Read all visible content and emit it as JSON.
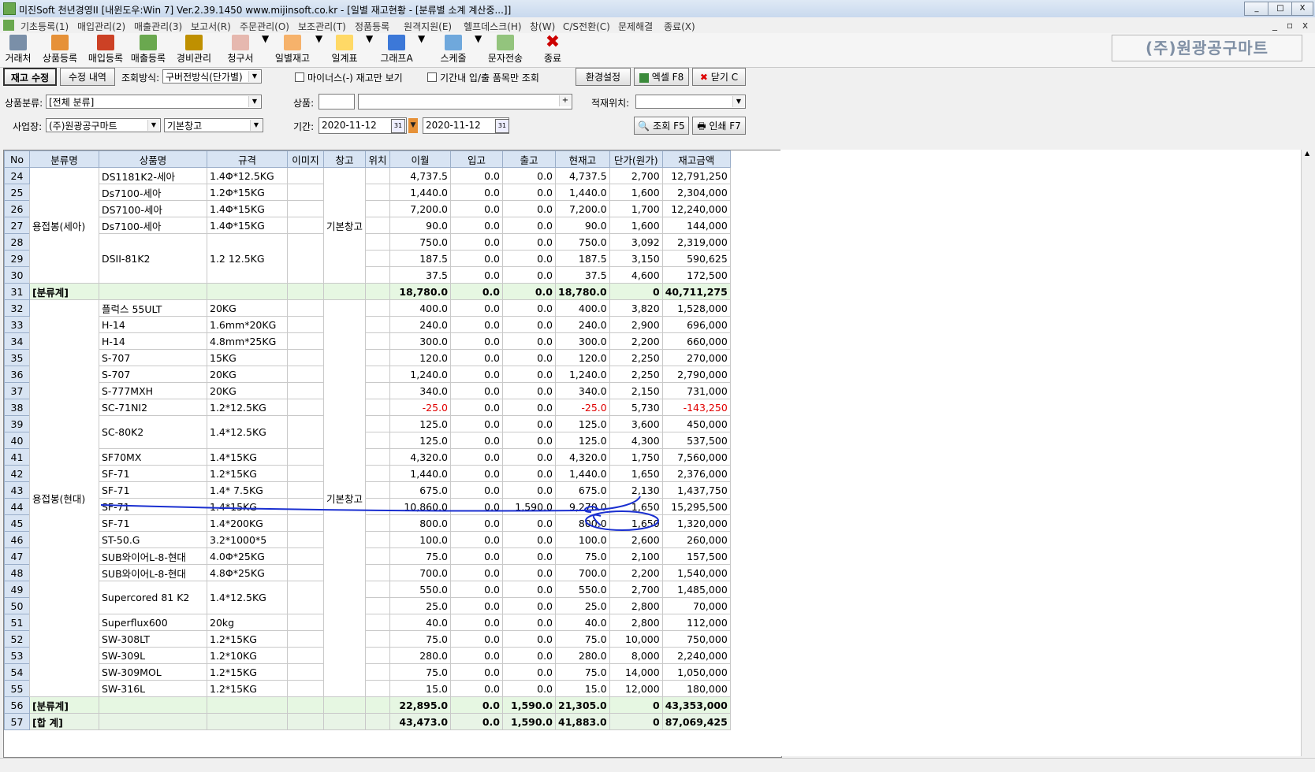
{
  "window": {
    "title": "미진Soft 천년경영II [내윈도우:Win 7] Ver.2.39.1450          www.mijinsoft.co.kr - [일별 재고현황 - [분류별 소계 계산중...]]",
    "minimize": "_",
    "restore": "□",
    "close": "X"
  },
  "menu": [
    "기초등록(1)",
    "매입관리(2)",
    "매출관리(3)",
    "보고서(R)",
    "주문관리(O)",
    "보조관리(T)",
    "정품등록",
    "원격지원(E)",
    "헬프데스크(H)",
    "창(W)",
    "C/S전환(C)",
    "문제해결",
    "종료(X)"
  ],
  "toolbar": [
    {
      "label": "거래처",
      "icon": "building-icon",
      "color": "#7a8fa8"
    },
    {
      "label": "상품등록",
      "icon": "box-add-icon",
      "color": "#e69138"
    },
    {
      "label": "매입등록",
      "icon": "purchase-icon",
      "color": "#cc4125"
    },
    {
      "label": "매출등록",
      "icon": "sales-icon",
      "color": "#6aa84f"
    },
    {
      "label": "경비관리",
      "icon": "money-icon",
      "color": "#bf9000"
    },
    {
      "label": "청구서",
      "icon": "invoice-icon",
      "color": "#e6b8af"
    },
    {
      "label": "일별재고",
      "icon": "daily-stock-icon",
      "color": "#f6b26b"
    },
    {
      "label": "일계표",
      "icon": "ledger-icon",
      "color": "#ffd966"
    },
    {
      "label": "그래프A",
      "icon": "chart-icon",
      "color": "#3c78d8"
    },
    {
      "label": "스케줄",
      "icon": "calendar-icon",
      "color": "#6fa8dc"
    },
    {
      "label": "문자전송",
      "icon": "sms-icon",
      "color": "#93c47d"
    },
    {
      "label": "종료",
      "icon": "close-x-icon",
      "color": "#cc0000"
    }
  ],
  "company_name": "(주)원광공구마트",
  "controls": {
    "stock_edit": "재고 수정",
    "edit_history": "수정 내역",
    "query_method_label": "조회방식:",
    "query_method_value": "구버전방식(단가별)",
    "minus_only": "마이너스(-) 재고만 보기",
    "period_inout_only": "기간내 입/출 품목만 조회",
    "env_settings": "환경설정",
    "excel": "엑셀 F8",
    "close": "닫기 C",
    "category_label": "상품분류:",
    "category_value": "[전체 분류]",
    "product_label": "상품:",
    "location_label": "적재위치:",
    "business_label": "사업장:",
    "business_value": "(주)원광공구마트",
    "warehouse_value": "기본창고",
    "period_label": "기간:",
    "date_from": "2020-11-12",
    "date_to": "2020-11-12",
    "search": "조회 F5",
    "print": "인쇄 F7"
  },
  "table": {
    "headers": [
      "No",
      "분류명",
      "상품명",
      "규격",
      "이미지",
      "창고",
      "위치",
      "이월",
      "입고",
      "출고",
      "현재고",
      "단가(원가)",
      "재고금액"
    ],
    "rows": [
      {
        "no": "24",
        "name": "DS1181K2-세아",
        "spec": "1.4Φ*12.5KG",
        "carry": "4,737.5",
        "in": "0.0",
        "out": "0.0",
        "stock": "4,737.5",
        "price": "2,700",
        "amount": "12,791,250"
      },
      {
        "no": "25",
        "name": "Ds7100-세아",
        "spec": "1.2Φ*15KG",
        "carry": "1,440.0",
        "in": "0.0",
        "out": "0.0",
        "stock": "1,440.0",
        "price": "1,600",
        "amount": "2,304,000"
      },
      {
        "no": "26",
        "name": "DS7100-세아",
        "spec": "1.4Φ*15KG",
        "carry": "7,200.0",
        "in": "0.0",
        "out": "0.0",
        "stock": "7,200.0",
        "price": "1,700",
        "amount": "12,240,000"
      },
      {
        "no": "27",
        "name": "Ds7100-세아",
        "spec": "1.4Φ*15KG",
        "carry": "90.0",
        "in": "0.0",
        "out": "0.0",
        "stock": "90.0",
        "price": "1,600",
        "amount": "144,000"
      },
      {
        "no": "28",
        "name": "",
        "spec": "",
        "carry": "750.0",
        "in": "0.0",
        "out": "0.0",
        "stock": "750.0",
        "price": "3,092",
        "amount": "2,319,000"
      },
      {
        "no": "29",
        "name": "DSII-81K2",
        "spec": "1.2 12.5KG",
        "carry": "187.5",
        "in": "0.0",
        "out": "0.0",
        "stock": "187.5",
        "price": "3,150",
        "amount": "590,625"
      },
      {
        "no": "30",
        "name": "",
        "spec": "",
        "carry": "37.5",
        "in": "0.0",
        "out": "0.0",
        "stock": "37.5",
        "price": "4,600",
        "amount": "172,500"
      },
      {
        "no": "31",
        "name": "",
        "spec": "",
        "carry": "18,780.0",
        "in": "0.0",
        "out": "0.0",
        "stock": "18,780.0",
        "price": "0",
        "amount": "40,711,275"
      },
      {
        "no": "32",
        "name": "플럭스 55ULT",
        "spec": "20KG",
        "carry": "400.0",
        "in": "0.0",
        "out": "0.0",
        "stock": "400.0",
        "price": "3,820",
        "amount": "1,528,000"
      },
      {
        "no": "33",
        "name": "H-14",
        "spec": "1.6mm*20KG",
        "carry": "240.0",
        "in": "0.0",
        "out": "0.0",
        "stock": "240.0",
        "price": "2,900",
        "amount": "696,000"
      },
      {
        "no": "34",
        "name": "H-14",
        "spec": "4.8mm*25KG",
        "carry": "300.0",
        "in": "0.0",
        "out": "0.0",
        "stock": "300.0",
        "price": "2,200",
        "amount": "660,000"
      },
      {
        "no": "35",
        "name": "S-707",
        "spec": "15KG",
        "carry": "120.0",
        "in": "0.0",
        "out": "0.0",
        "stock": "120.0",
        "price": "2,250",
        "amount": "270,000"
      },
      {
        "no": "36",
        "name": "S-707",
        "spec": "20KG",
        "carry": "1,240.0",
        "in": "0.0",
        "out": "0.0",
        "stock": "1,240.0",
        "price": "2,250",
        "amount": "2,790,000"
      },
      {
        "no": "37",
        "name": "S-777MXH",
        "spec": "20KG",
        "carry": "340.0",
        "in": "0.0",
        "out": "0.0",
        "stock": "340.0",
        "price": "2,150",
        "amount": "731,000"
      },
      {
        "no": "38",
        "name": "SC-71NI2",
        "spec": "1.2*12.5KG",
        "carry": "-25.0",
        "in": "0.0",
        "out": "0.0",
        "stock": "-25.0",
        "price": "5,730",
        "amount": "-143,250"
      },
      {
        "no": "39",
        "name": "",
        "spec": "",
        "carry": "125.0",
        "in": "0.0",
        "out": "0.0",
        "stock": "125.0",
        "price": "3,600",
        "amount": "450,000"
      },
      {
        "no": "40",
        "name": "SC-80K2",
        "spec": "1.4*12.5KG",
        "carry": "125.0",
        "in": "0.0",
        "out": "0.0",
        "stock": "125.0",
        "price": "4,300",
        "amount": "537,500"
      },
      {
        "no": "41",
        "name": "SF70MX",
        "spec": "1.4*15KG",
        "carry": "4,320.0",
        "in": "0.0",
        "out": "0.0",
        "stock": "4,320.0",
        "price": "1,750",
        "amount": "7,560,000"
      },
      {
        "no": "42",
        "name": "SF-71",
        "spec": "1.2*15KG",
        "carry": "1,440.0",
        "in": "0.0",
        "out": "0.0",
        "stock": "1,440.0",
        "price": "1,650",
        "amount": "2,376,000"
      },
      {
        "no": "43",
        "name": "SF-71",
        "spec": "1.4* 7.5KG",
        "carry": "675.0",
        "in": "0.0",
        "out": "0.0",
        "stock": "675.0",
        "price": "2,130",
        "amount": "1,437,750"
      },
      {
        "no": "44",
        "name": "SF-71",
        "spec": "1.4*15KG",
        "carry": "10,860.0",
        "in": "0.0",
        "out": "1,590.0",
        "stock": "9,270.0",
        "price": "1,650",
        "amount": "15,295,500"
      },
      {
        "no": "45",
        "name": "SF-71",
        "spec": "1.4*200KG",
        "carry": "800.0",
        "in": "0.0",
        "out": "0.0",
        "stock": "800.0",
        "price": "1,650",
        "amount": "1,320,000"
      },
      {
        "no": "46",
        "name": "ST-50.G",
        "spec": "3.2*1000*5",
        "carry": "100.0",
        "in": "0.0",
        "out": "0.0",
        "stock": "100.0",
        "price": "2,600",
        "amount": "260,000"
      },
      {
        "no": "47",
        "name": "SUB와이어L-8-현대",
        "spec": "4.0Φ*25KG",
        "carry": "75.0",
        "in": "0.0",
        "out": "0.0",
        "stock": "75.0",
        "price": "2,100",
        "amount": "157,500"
      },
      {
        "no": "48",
        "name": "SUB와이어L-8-현대",
        "spec": "4.8Φ*25KG",
        "carry": "700.0",
        "in": "0.0",
        "out": "0.0",
        "stock": "700.0",
        "price": "2,200",
        "amount": "1,540,000"
      },
      {
        "no": "49",
        "name": "",
        "spec": "",
        "carry": "550.0",
        "in": "0.0",
        "out": "0.0",
        "stock": "550.0",
        "price": "2,700",
        "amount": "1,485,000"
      },
      {
        "no": "50",
        "name": "Supercored 81 K2",
        "spec": "1.4*12.5KG",
        "carry": "25.0",
        "in": "0.0",
        "out": "0.0",
        "stock": "25.0",
        "price": "2,800",
        "amount": "70,000"
      },
      {
        "no": "51",
        "name": "Superflux600",
        "spec": "20kg",
        "carry": "40.0",
        "in": "0.0",
        "out": "0.0",
        "stock": "40.0",
        "price": "2,800",
        "amount": "112,000"
      },
      {
        "no": "52",
        "name": "SW-308LT",
        "spec": "1.2*15KG",
        "carry": "75.0",
        "in": "0.0",
        "out": "0.0",
        "stock": "75.0",
        "price": "10,000",
        "amount": "750,000"
      },
      {
        "no": "53",
        "name": "SW-309L",
        "spec": "1.2*10KG",
        "carry": "280.0",
        "in": "0.0",
        "out": "0.0",
        "stock": "280.0",
        "price": "8,000",
        "amount": "2,240,000"
      },
      {
        "no": "54",
        "name": "SW-309MOL",
        "spec": "1.2*15KG",
        "carry": "75.0",
        "in": "0.0",
        "out": "0.0",
        "stock": "75.0",
        "price": "14,000",
        "amount": "1,050,000"
      },
      {
        "no": "55",
        "name": "SW-316L",
        "spec": "1.2*15KG",
        "carry": "15.0",
        "in": "0.0",
        "out": "0.0",
        "stock": "15.0",
        "price": "12,000",
        "amount": "180,000"
      },
      {
        "no": "56",
        "name": "",
        "spec": "",
        "carry": "22,895.0",
        "in": "0.0",
        "out": "1,590.0",
        "stock": "21,305.0",
        "price": "0",
        "amount": "43,353,000"
      },
      {
        "no": "57",
        "name": "",
        "spec": "",
        "carry": "43,473.0",
        "in": "0.0",
        "out": "1,590.0",
        "stock": "41,883.0",
        "price": "0",
        "amount": "87,069,425"
      }
    ],
    "group1_label": "용접봉(세아)",
    "group2_label": "용접봉(현대)",
    "subtotal_label": "[분류계]",
    "total_label": "[합 계]",
    "warehouse_label": "기본창고"
  },
  "colors": {
    "header_bg": "#d8e4f3",
    "subtotal_bg": "#e6f7e2",
    "negative": "#e00000",
    "annotation": "#1a2fd0"
  }
}
